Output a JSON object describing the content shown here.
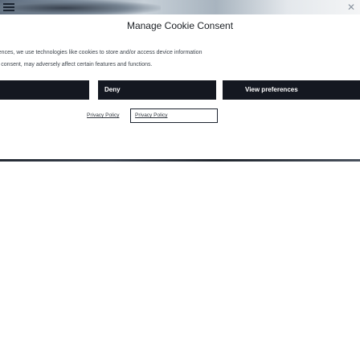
{
  "consent": {
    "title": "Manage Cookie Consent",
    "body_line_1": "eriences, we use technologies like cookies to store and/or access device information",
    "body_line_2": "ing consent, may adversely affect certain features and functions.",
    "buttons": {
      "accept": "",
      "deny": "Deny",
      "preferences": "View preferences"
    },
    "links": {
      "privacy_policy_1": "Privacy Policy",
      "privacy_policy_2": "Privacy Policy"
    }
  },
  "icons": {
    "menu": "hamburger-menu-icon",
    "close": "close-icon"
  },
  "colors": {
    "button_bg": "#141821",
    "button_text": "#ffffff",
    "text": "#1b1f24",
    "body_text": "#3d444c"
  }
}
